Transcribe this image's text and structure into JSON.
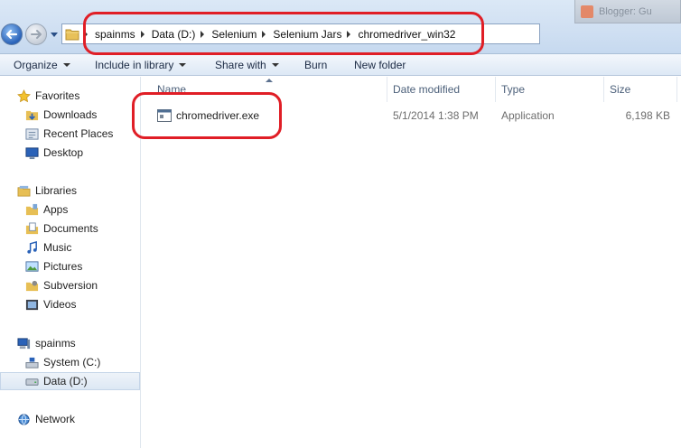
{
  "browser_tab": {
    "label": "Blogger: Gu"
  },
  "address_bar": {
    "crumbs": [
      "spainms",
      "Data (D:)",
      "Selenium",
      "Selenium Jars",
      "chromedriver_win32"
    ]
  },
  "toolbar": {
    "organize": "Organize",
    "include_in_library": "Include in library",
    "share_with": "Share with",
    "burn": "Burn",
    "new_folder": "New folder"
  },
  "navigation": {
    "favorites": {
      "label": "Favorites",
      "items": [
        "Downloads",
        "Recent Places",
        "Desktop"
      ]
    },
    "libraries": {
      "label": "Libraries",
      "items": [
        "Apps",
        "Documents",
        "Music",
        "Pictures",
        "Subversion",
        "Videos"
      ]
    },
    "computer": {
      "label": "spainms",
      "items": [
        "System (C:)",
        "Data (D:)"
      ]
    },
    "network": {
      "label": "Network"
    }
  },
  "columns": {
    "name": "Name",
    "date_modified": "Date modified",
    "type": "Type",
    "size": "Size"
  },
  "files": [
    {
      "name": "chromedriver.exe",
      "date_modified": "5/1/2014 1:38 PM",
      "type": "Application",
      "size": "6,198 KB"
    }
  ],
  "colors": {
    "annotation_red": "#e01e26",
    "accent": "#2a62b8"
  }
}
